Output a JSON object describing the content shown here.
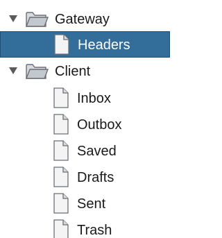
{
  "tree": {
    "gateway": {
      "label": "Gateway",
      "expanded": true,
      "children": [
        {
          "label": "Headers",
          "selected": true
        }
      ]
    },
    "client": {
      "label": "Client",
      "expanded": true,
      "children": [
        {
          "label": "Inbox"
        },
        {
          "label": "Outbox"
        },
        {
          "label": "Saved"
        },
        {
          "label": "Drafts"
        },
        {
          "label": "Sent"
        },
        {
          "label": "Trash"
        }
      ]
    }
  },
  "colors": {
    "selection_background": "#336d9a",
    "selection_text": "#ffffff",
    "folder": "#c9ced4",
    "document": "#f4f4f4"
  },
  "icons": {
    "expander": "triangle-down-icon",
    "folder": "folder-open-icon",
    "leaf": "document-icon"
  }
}
